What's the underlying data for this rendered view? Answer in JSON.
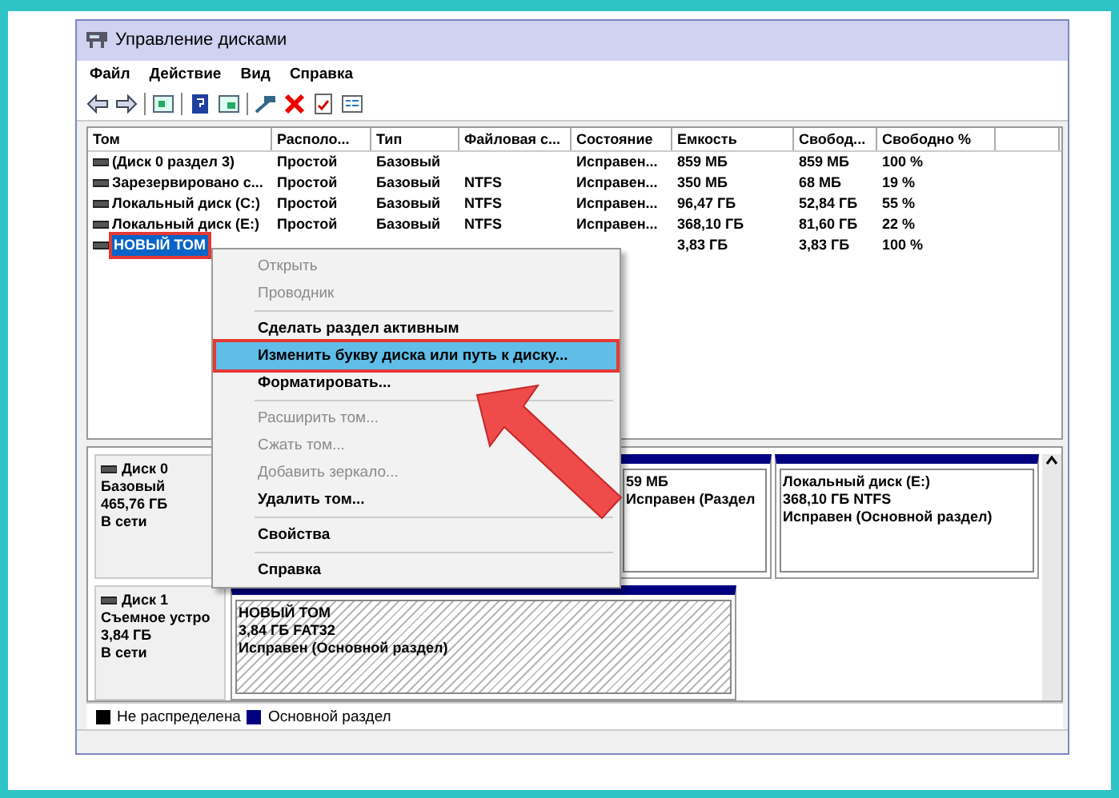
{
  "window": {
    "title": "Управление дисками"
  },
  "menu": [
    "Файл",
    "Действие",
    "Вид",
    "Справка"
  ],
  "volumes": {
    "columns": [
      "Том",
      "Располо...",
      "Тип",
      "Файловая с...",
      "Состояние",
      "Емкость",
      "Свобод...",
      "Свободно %"
    ],
    "rows": [
      {
        "volume": "(Диск 0 раздел 3)",
        "layout": "Простой",
        "type": "Базовый",
        "status": "Исправен...",
        "capacity": "859 МБ",
        "free": "859 МБ",
        "free_percent": "100 %",
        "selected": false
      },
      {
        "volume": "Зарезервировано с...",
        "layout": "Простой",
        "type": "Базовый",
        "file_system": "NTFS",
        "status": "Исправен...",
        "capacity": "350 МБ",
        "free": "68 МБ",
        "free_percent": "19 %",
        "selected": false
      },
      {
        "volume": "Локальный диск (C:)",
        "layout": "Простой",
        "type": "Базовый",
        "file_system": "NTFS",
        "status": "Исправен...",
        "capacity": "96,47 ГБ",
        "free": "52,84 ГБ",
        "free_percent": "55 %",
        "selected": false
      },
      {
        "volume": "Локальный диск (E:)",
        "layout": "Простой",
        "type": "Базовый",
        "file_system": "NTFS",
        "status": "Исправен...",
        "capacity": "368,10 ГБ",
        "free": "81,60 ГБ",
        "free_percent": "22 %",
        "selected": false
      },
      {
        "volume": "НОВЫЙ ТОМ",
        "capacity": "3,83 ГБ",
        "free": "3,83 ГБ",
        "free_percent": "100 %",
        "selected": true
      }
    ]
  },
  "context_menu": [
    {
      "kind": "item",
      "label": "Открыть",
      "disabled": true,
      "selected": false
    },
    {
      "kind": "item",
      "label": "Проводник",
      "disabled": true,
      "selected": false
    },
    {
      "kind": "separator"
    },
    {
      "kind": "item",
      "label": "Сделать раздел активным",
      "disabled": false,
      "selected": false
    },
    {
      "kind": "item",
      "label": "Изменить букву диска или путь к диску...",
      "disabled": false,
      "selected": true
    },
    {
      "kind": "item",
      "label": "Форматировать...",
      "disabled": false,
      "selected": false
    },
    {
      "kind": "separator"
    },
    {
      "kind": "item",
      "label": "Расширить том...",
      "disabled": true,
      "selected": false
    },
    {
      "kind": "item",
      "label": "Сжать том...",
      "disabled": true,
      "selected": false
    },
    {
      "kind": "item",
      "label": "Добавить зеркало...",
      "disabled": true,
      "selected": false
    },
    {
      "kind": "item",
      "label": "Удалить том...",
      "disabled": false,
      "selected": false
    },
    {
      "kind": "separator"
    },
    {
      "kind": "item",
      "label": "Свойства",
      "disabled": false,
      "selected": false
    },
    {
      "kind": "separator"
    },
    {
      "kind": "item",
      "label": "Справка",
      "disabled": false,
      "selected": false
    }
  ],
  "disks": [
    {
      "name": "Диск 0",
      "type": "Базовый",
      "size": "465,76 ГБ",
      "status": "В сети",
      "partitions": [
        {
          "lines": [
            "59 МБ",
            "Исправен (Раздел"
          ],
          "selected": false
        },
        {
          "title": "Локальный диск  (E:)",
          "lines": [
            "368,10 ГБ NTFS",
            "Исправен (Основной раздел)"
          ],
          "selected": false
        }
      ]
    },
    {
      "name": "Диск 1",
      "type": "Съемное устро",
      "size": "3,84 ГБ",
      "status": "В сети",
      "partitions": [
        {
          "title": "НОВЫЙ ТОМ",
          "lines": [
            "3,84 ГБ FAT32",
            "Исправен (Основной раздел)"
          ],
          "selected": true
        }
      ]
    }
  ],
  "legend": [
    {
      "label": "Не распределена",
      "color": "#000000"
    },
    {
      "label": "Основной раздел",
      "color": "#000080"
    }
  ]
}
